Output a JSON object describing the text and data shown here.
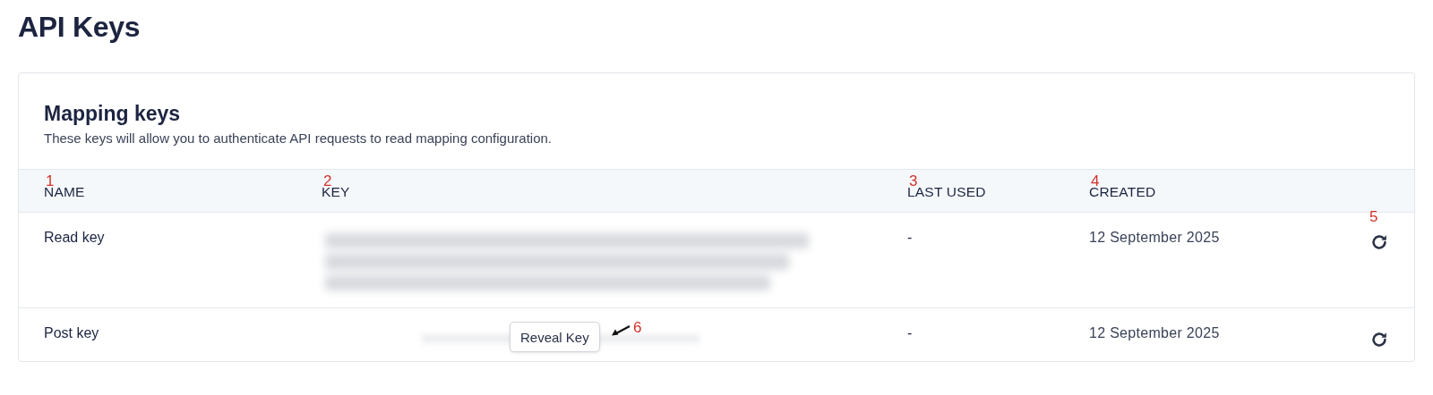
{
  "page_title": "API Keys",
  "card": {
    "title": "Mapping keys",
    "description": "These keys will allow you to authenticate API requests to read mapping configuration.",
    "table": {
      "columns": [
        {
          "label": "NAME",
          "marker": "1"
        },
        {
          "label": "KEY",
          "marker": "2"
        },
        {
          "label": "LAST USED",
          "marker": "3"
        },
        {
          "label": "CREATED",
          "marker": "4"
        }
      ],
      "action_marker": "5",
      "rows": [
        {
          "name": "Read key",
          "key": {
            "kind": "blurred"
          },
          "last_used": "-",
          "created": "12 September 2025"
        },
        {
          "name": "Post key",
          "key": {
            "kind": "hidden"
          },
          "reveal_button": "Reveal Key",
          "reveal_marker": "6",
          "last_used": "-",
          "created": "12 September 2025"
        }
      ]
    }
  }
}
